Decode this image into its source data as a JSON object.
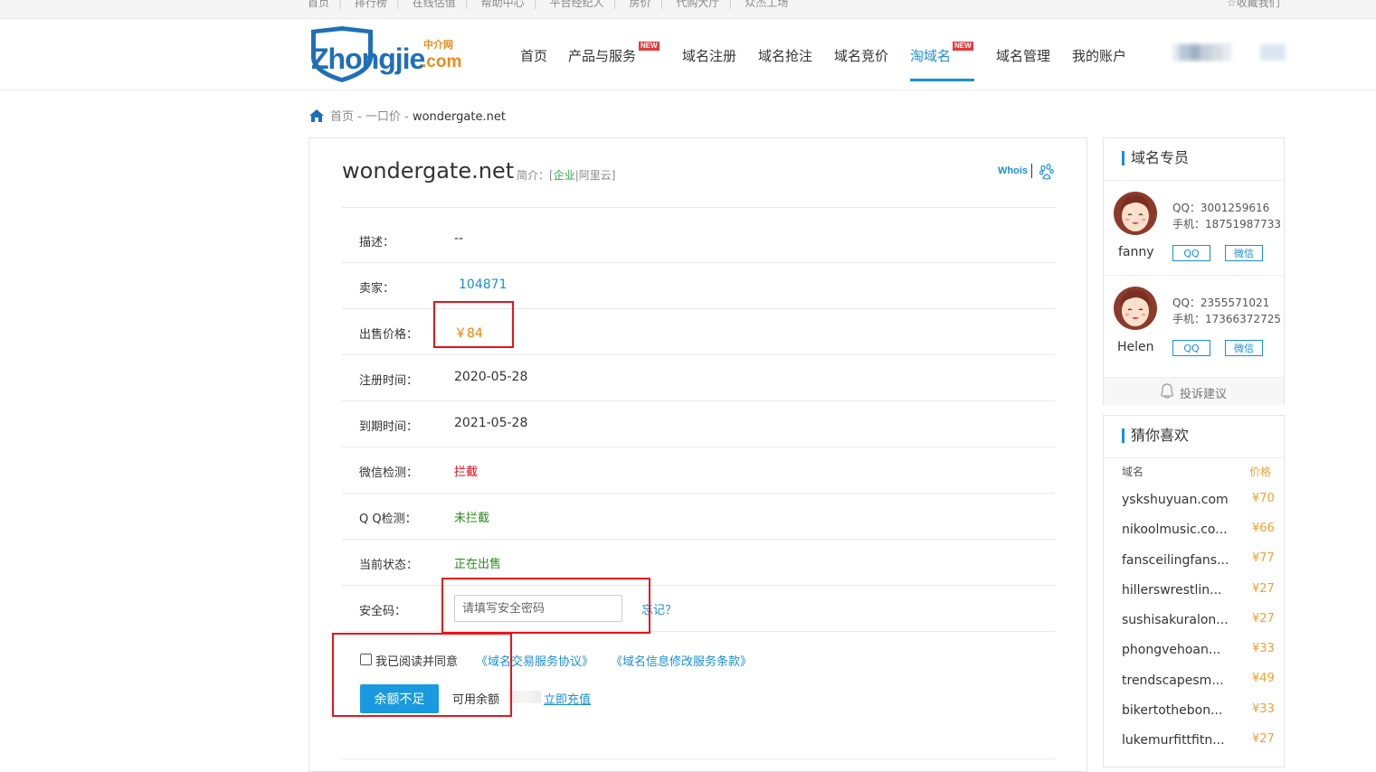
{
  "topbar": {
    "links": [
      "首页",
      "排行榜",
      "在线估值",
      "帮助中心",
      "平台经纪人",
      "房价",
      "代购大厅",
      "众杰工场"
    ],
    "favorite": "收藏我们"
  },
  "logo": {
    "text": "Zhongjie",
    "cn": "中介网",
    "com": ".com"
  },
  "nav": {
    "items": [
      {
        "label": "首页"
      },
      {
        "label": "产品与服务",
        "badge": "NEW"
      },
      {
        "label": "域名注册"
      },
      {
        "label": "域名抢注"
      },
      {
        "label": "域名竞价"
      },
      {
        "label": "淘域名",
        "badge": "NEW",
        "active": true
      },
      {
        "label": "域名管理"
      },
      {
        "label": "我的账户"
      }
    ]
  },
  "breadcrumb": {
    "home": "首页",
    "sep": " - ",
    "level2": "一口价",
    "current": "wondergate.net"
  },
  "domain": {
    "name": "wondergate.net",
    "intro_prefix": "简介：[",
    "intro_tag": "企业",
    "intro_rest": "|阿里云]",
    "whois": "Whois"
  },
  "details": [
    {
      "label": "描述：",
      "value": "--",
      "style": "normal"
    },
    {
      "label": "卖家：",
      "value": "104871",
      "style": "blue"
    },
    {
      "label": "出售价格：",
      "value": "￥84",
      "style": "orange"
    },
    {
      "label": "注册时间：",
      "value": "2020-05-28",
      "style": "normal"
    },
    {
      "label": "到期时间：",
      "value": "2021-05-28",
      "style": "normal"
    },
    {
      "label": "微信检测：",
      "value": "拦截",
      "style": "red"
    },
    {
      "label": "Q Q检测：",
      "value": "未拦截",
      "style": "green"
    },
    {
      "label": "当前状态：",
      "value": "正在出售",
      "style": "green"
    }
  ],
  "security": {
    "label": "安全码：",
    "placeholder": "请填写安全密码",
    "forget": "忘记？"
  },
  "agreement": {
    "text": "我已阅读并同意",
    "link1": "《域名交易服务协议》",
    "link2": "《域名信息修改服务条款》"
  },
  "payment": {
    "button": "余额不足",
    "balance_label": "可用余额",
    "recharge": "立即充值"
  },
  "agents": {
    "title": "域名专员",
    "list": [
      {
        "name": "fanny",
        "qq": "QQ：3001259616",
        "phone": "手机：18751987733",
        "qq_btn": "QQ",
        "wx_btn": "微信"
      },
      {
        "name": "Helen",
        "qq": "QQ：2355571021",
        "phone": "手机：17366372725",
        "qq_btn": "QQ",
        "wx_btn": "微信"
      }
    ],
    "complaint": "投诉建议"
  },
  "guess": {
    "title": "猜你喜欢",
    "col_domain": "域名",
    "col_price": "价格",
    "items": [
      {
        "domain": "yskshuyuan.com",
        "price": "¥70"
      },
      {
        "domain": "nikoolmusic.co...",
        "price": "¥66"
      },
      {
        "domain": "fansceilingfans...",
        "price": "¥77"
      },
      {
        "domain": "hillerswrestlin...",
        "price": "¥27"
      },
      {
        "domain": "sushisakuralon...",
        "price": "¥27"
      },
      {
        "domain": "phongvehoan...",
        "price": "¥33"
      },
      {
        "domain": "trendscapesm...",
        "price": "¥49"
      },
      {
        "domain": "bikertothebon...",
        "price": "¥33"
      },
      {
        "domain": "lukemurfittfitn...",
        "price": "¥27"
      }
    ]
  },
  "colors": {
    "accent": "#1a8fd8",
    "price": "#f08200",
    "danger": "#e60012",
    "ok": "#2a8a1e",
    "highlight": "#e8131b"
  }
}
